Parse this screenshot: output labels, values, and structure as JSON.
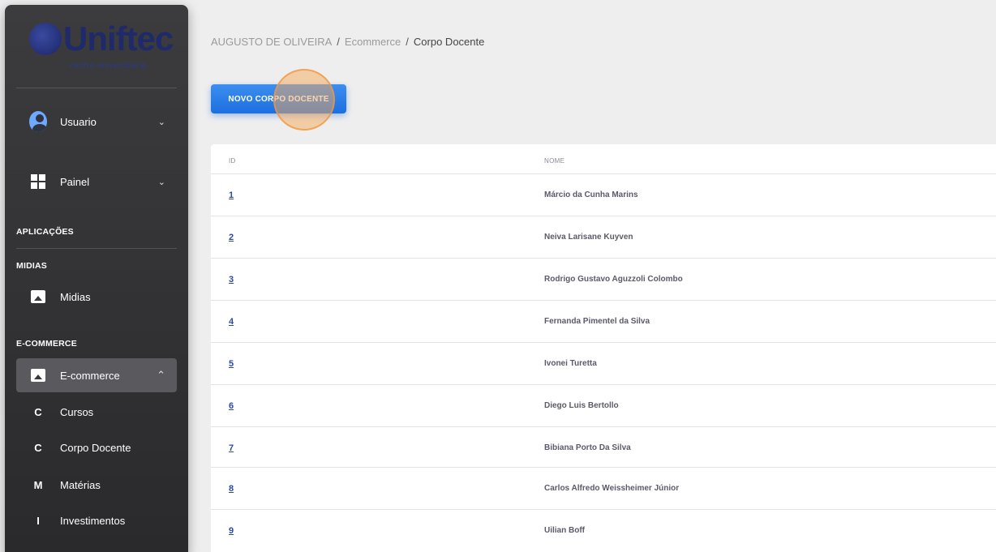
{
  "sidebar": {
    "logo": {
      "word": "Uniftec",
      "subtitle": "centro universitário"
    },
    "user": {
      "label": "Usuario"
    },
    "dashboard": {
      "label": "Painel"
    },
    "section_apps": "APLICAÇÕES",
    "section_midias": "MIDIAS",
    "midias": {
      "label": "Midias"
    },
    "section_ecommerce": "E-COMMERCE",
    "ecommerce": {
      "label": "E-commerce"
    },
    "submenu": [
      {
        "letter": "C",
        "label": "Cursos"
      },
      {
        "letter": "C",
        "label": "Corpo Docente"
      },
      {
        "letter": "M",
        "label": "Matérias"
      },
      {
        "letter": "I",
        "label": "Investimentos"
      }
    ]
  },
  "breadcrumb": {
    "user": "AUGUSTO DE OLIVEIRA",
    "section": "Ecommerce",
    "current": "Corpo Docente",
    "separator": "/"
  },
  "toolbar": {
    "new_label": "NOVO CORPO DOCENTE"
  },
  "table": {
    "headers": {
      "id": "ID",
      "name": "NOME"
    },
    "rows": [
      {
        "id": "1",
        "name": "Márcio da Cunha Marins"
      },
      {
        "id": "2",
        "name": "Neiva Larisane Kuyven"
      },
      {
        "id": "3",
        "name": "Rodrigo Gustavo Aguzzoli Colombo"
      },
      {
        "id": "4",
        "name": "Fernanda Pimentel da Silva"
      },
      {
        "id": "5",
        "name": "Ivonei Turetta"
      },
      {
        "id": "6",
        "name": "Diego Luis Bertollo"
      },
      {
        "id": "7",
        "name": "Bibiana Porto Da Silva"
      },
      {
        "id": "8",
        "name": "Carlos Alfredo Weissheimer Júnior"
      },
      {
        "id": "9",
        "name": "Uilian Boff"
      }
    ]
  },
  "colors": {
    "accent": "#1c6fe0",
    "sidebar_bg": "#2a2a2c",
    "cursor_highlight": "#f6aa5a"
  }
}
